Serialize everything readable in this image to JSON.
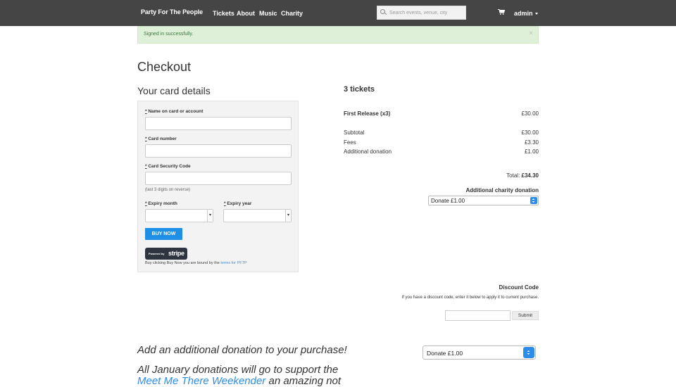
{
  "nav": {
    "brand": "Party For The People",
    "links": [
      "Tickets",
      "About",
      "Music",
      "Charity"
    ],
    "search_placeholder": "Search events, venue, city",
    "user": "admin"
  },
  "alert": {
    "message": "Signed in successfully.",
    "close": "×"
  },
  "page_title": "Checkout",
  "card": {
    "heading": "Your card details",
    "required_mark": "*",
    "name_label": "Name on card or account",
    "number_label": "Card number",
    "cvc_label": "Card Security Code",
    "cvc_hint": "(last 3 digits on reverse)",
    "month_label": "Expiry month",
    "year_label": "Expiry year",
    "buy_label": "BUY NOW",
    "powered_by": "Powered by",
    "stripe": "stripe",
    "terms_text": "Buy clicking Buy Now you are bound by the",
    "terms_link": "terms for PFTP"
  },
  "summary": {
    "heading": "3 tickets",
    "line_item": {
      "label": "First Release (x3)",
      "value": "£30.00"
    },
    "subtotal": {
      "label": "Subtotal",
      "value": "£30.00"
    },
    "fees": {
      "label": "Fees",
      "value": "£3.30"
    },
    "donation": {
      "label": "Additional donation",
      "value": "£1.00"
    },
    "total_label": "Total:",
    "total_value": "£34.30",
    "charity_heading": "Additional charity donation",
    "charity_selected": "Donate £1.00"
  },
  "discount": {
    "heading": "Discount Code",
    "text": "If you have a discount code, enter it below to apply it to current purchase.",
    "submit": "Submit"
  },
  "donation_section": {
    "heading": "Add an additional donation to your purchase!",
    "selected": "Donate £1.00",
    "january_text": "All January donations will go to support the",
    "link_text": "Meet Me There Weekender",
    "after_link": "an amazing not"
  }
}
